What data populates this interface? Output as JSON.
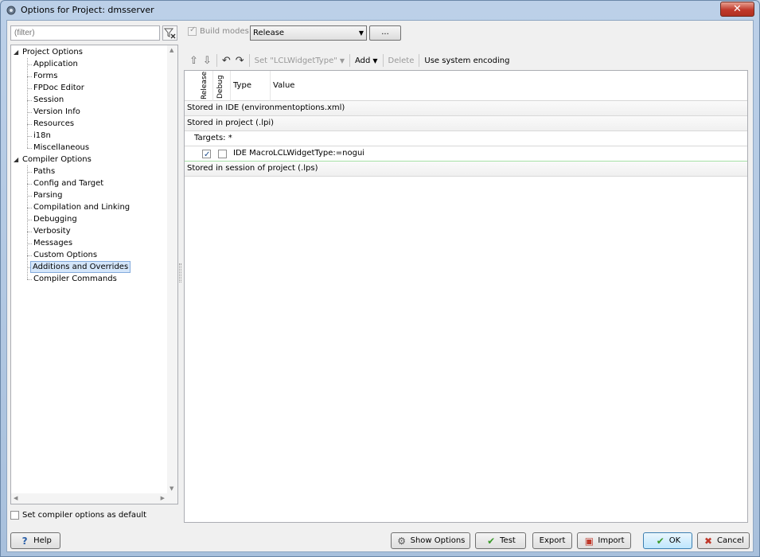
{
  "window": {
    "title": "Options for Project: dmsserver",
    "close_label": "✕"
  },
  "filter": {
    "placeholder": "(filter)"
  },
  "tree": {
    "groups": [
      {
        "label": "Project Options",
        "children": [
          "Application",
          "Forms",
          "FPDoc Editor",
          "Session",
          "Version Info",
          "Resources",
          "i18n",
          "Miscellaneous"
        ]
      },
      {
        "label": "Compiler Options",
        "children": [
          "Paths",
          "Config and Target",
          "Parsing",
          "Compilation and Linking",
          "Debugging",
          "Verbosity",
          "Messages",
          "Custom Options",
          "Additions and Overrides",
          "Compiler Commands"
        ]
      }
    ],
    "selected": "Additions and Overrides"
  },
  "default_checkbox": {
    "label": "Set compiler options as default",
    "checked": false
  },
  "buildmodes": {
    "label": "Build modes",
    "checked": true,
    "selected": "Release",
    "ellipsis": "..."
  },
  "toolbar": {
    "set_label": "Set \"LCLWidgetType\"",
    "add_label": "Add",
    "delete_label": "Delete",
    "encoding_label": "Use system encoding"
  },
  "grid": {
    "headers": {
      "release": "Release",
      "debug": "Debug",
      "type": "Type",
      "value": "Value"
    },
    "rows": {
      "ide": "Stored in IDE (environmentoptions.xml)",
      "project": "Stored in project (.lpi)",
      "targets": "Targets: *",
      "item": {
        "release_checked": true,
        "debug_checked": false,
        "type": "IDE Macro",
        "value": "LCLWidgetType:=nogui"
      },
      "session": "Stored in session of project (.lps)"
    }
  },
  "buttons": {
    "help": "Help",
    "show_options": "Show Options",
    "test": "Test",
    "export": "Export",
    "import": "Import",
    "ok": "OK",
    "cancel": "Cancel"
  },
  "colors": {
    "ok_icon": "#3a9a2a",
    "cancel_icon": "#c0392b",
    "help_icon": "#2a5fa8"
  }
}
